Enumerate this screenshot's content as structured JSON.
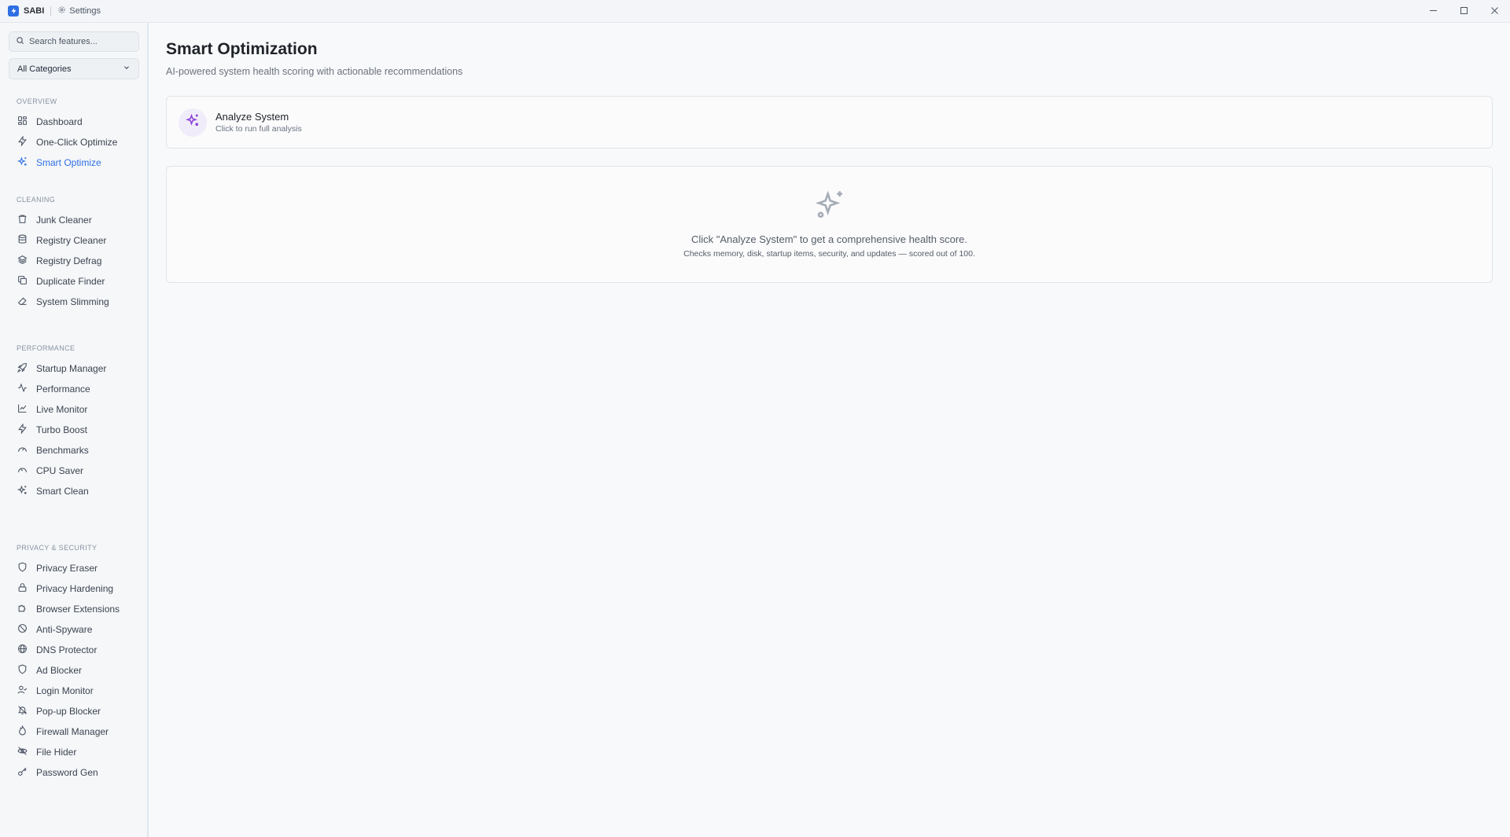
{
  "window": {
    "app_name": "SABI",
    "settings_label": "Settings",
    "accent_color": "#2f6fe4",
    "controls": [
      "minimize-icon",
      "maximize-icon",
      "close-icon"
    ]
  },
  "sidebar": {
    "search": {
      "placeholder": "Search features...",
      "value": ""
    },
    "category_select": {
      "selected": "All Categories"
    },
    "sections": [
      {
        "label": "OVERVIEW",
        "items": [
          {
            "label": "Dashboard",
            "icon": "dashboard-icon"
          },
          {
            "label": "One-Click Optimize",
            "icon": "zap-icon"
          },
          {
            "label": "Smart Optimize",
            "icon": "sparkles-icon",
            "active": true
          }
        ]
      },
      {
        "label": "CLEANING",
        "items": [
          {
            "label": "Junk Cleaner",
            "icon": "trash-icon"
          },
          {
            "label": "Registry Cleaner",
            "icon": "database-icon"
          },
          {
            "label": "Registry Defrag",
            "icon": "layers-icon"
          },
          {
            "label": "Duplicate Finder",
            "icon": "copy-icon"
          },
          {
            "label": "System Slimming",
            "icon": "eraser-icon"
          }
        ]
      },
      {
        "label": "PERFORMANCE",
        "items": [
          {
            "label": "Startup Manager",
            "icon": "rocket-icon"
          },
          {
            "label": "Performance",
            "icon": "activity-icon"
          },
          {
            "label": "Live Monitor",
            "icon": "line-chart-icon"
          },
          {
            "label": "Turbo Boost",
            "icon": "zap-icon"
          },
          {
            "label": "Benchmarks",
            "icon": "gauge-icon"
          },
          {
            "label": "CPU Saver",
            "icon": "gauge-icon"
          },
          {
            "label": "Smart Clean",
            "icon": "sparkles-icon"
          }
        ]
      },
      {
        "label": "PRIVACY & SECURITY",
        "items": [
          {
            "label": "Privacy Eraser",
            "icon": "shield-icon"
          },
          {
            "label": "Privacy Hardening",
            "icon": "lock-icon"
          },
          {
            "label": "Browser Extensions",
            "icon": "puzzle-icon"
          },
          {
            "label": "Anti-Spyware",
            "icon": "shield-off-icon"
          },
          {
            "label": "DNS Protector",
            "icon": "globe-icon"
          },
          {
            "label": "Ad Blocker",
            "icon": "shield-icon"
          },
          {
            "label": "Login Monitor",
            "icon": "user-check-icon"
          },
          {
            "label": "Pop-up Blocker",
            "icon": "bell-off-icon"
          },
          {
            "label": "Firewall Manager",
            "icon": "flame-icon"
          },
          {
            "label": "File Hider",
            "icon": "eye-off-icon"
          },
          {
            "label": "Password Gen",
            "icon": "key-icon"
          }
        ]
      }
    ]
  },
  "main": {
    "title": "Smart Optimization",
    "subtitle": "AI-powered system health scoring with actionable recommendations",
    "analyze_card": {
      "title": "Analyze System",
      "subtitle": "Click to run full analysis",
      "icon": "sparkles-icon",
      "icon_color": "#8b3fd9"
    },
    "empty_state": {
      "icon": "sparkles-icon",
      "message": "Click \"Analyze System\" to get a comprehensive health score.",
      "detail": "Checks memory, disk, startup items, security, and updates — scored out of 100."
    }
  }
}
